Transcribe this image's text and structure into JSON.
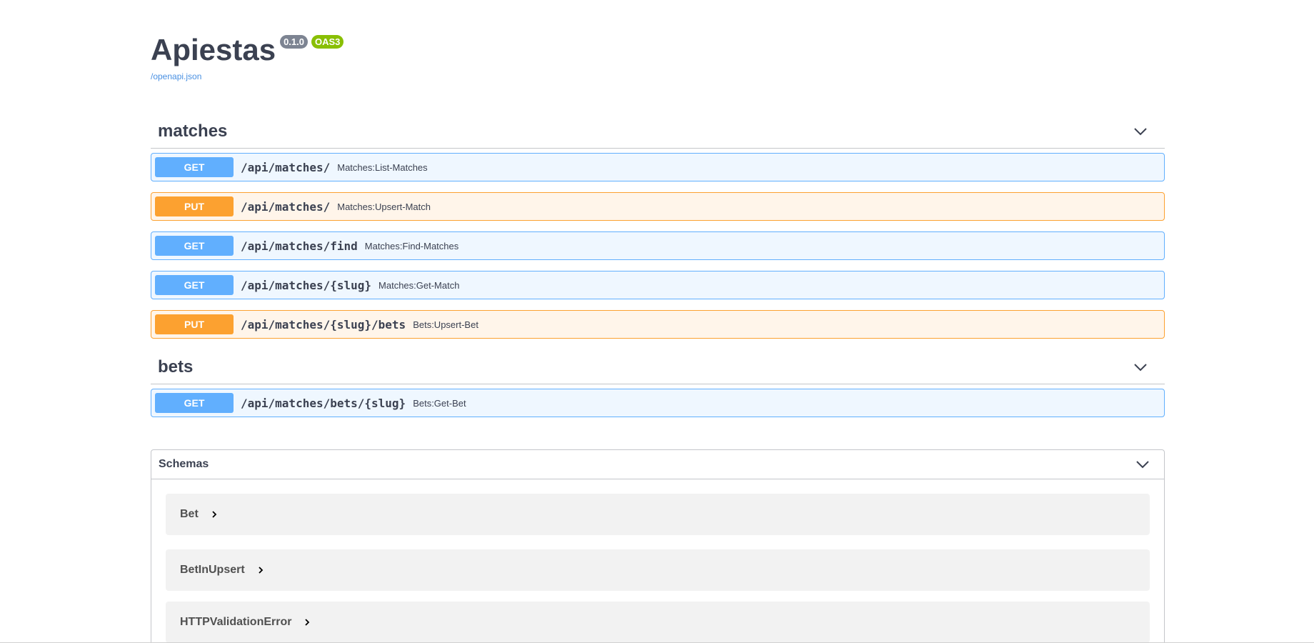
{
  "info": {
    "title": "Apiestas",
    "version": "0.1.0",
    "oas": "OAS3",
    "spec_link": "/openapi.json"
  },
  "tags": [
    {
      "name": "matches",
      "operations": [
        {
          "method": "GET",
          "path": "/api/matches/",
          "summary": "Matches:List-Matches"
        },
        {
          "method": "PUT",
          "path": "/api/matches/",
          "summary": "Matches:Upsert-Match"
        },
        {
          "method": "GET",
          "path": "/api/matches/find",
          "summary": "Matches:Find-Matches"
        },
        {
          "method": "GET",
          "path": "/api/matches/{slug}",
          "summary": "Matches:Get-Match"
        },
        {
          "method": "PUT",
          "path": "/api/matches/{slug}/bets",
          "summary": "Bets:Upsert-Bet"
        }
      ]
    },
    {
      "name": "bets",
      "operations": [
        {
          "method": "GET",
          "path": "/api/matches/bets/{slug}",
          "summary": "Bets:Get-Bet"
        }
      ]
    }
  ],
  "schemas": {
    "title": "Schemas",
    "models": [
      "Bet",
      "BetInUpsert",
      "HTTPValidationError"
    ]
  },
  "colors": {
    "get": "#61affe",
    "put": "#fca130",
    "badge_version": "#7d8492",
    "badge_oas": "#89bf04",
    "link": "#4990e2"
  }
}
